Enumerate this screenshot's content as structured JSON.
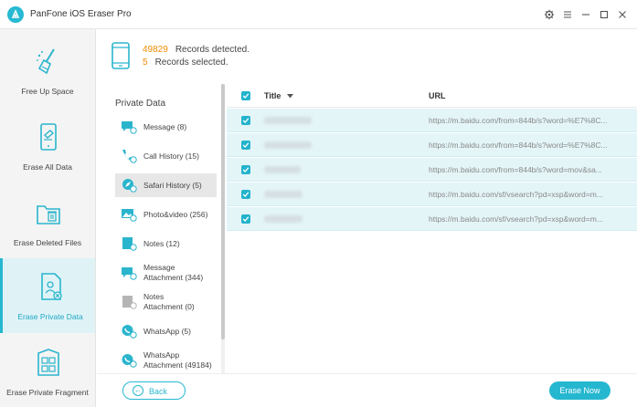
{
  "app": {
    "title": "PanFone iOS Eraser Pro"
  },
  "sidebar": {
    "items": [
      {
        "label": "Free Up Space"
      },
      {
        "label": "Erase All Data"
      },
      {
        "label": "Erase Deleted Files"
      },
      {
        "label": "Erase Private Data"
      },
      {
        "label": "Erase Private Fragment"
      }
    ]
  },
  "summary": {
    "detected_count": "49829",
    "detected_label": "Records detected.",
    "selected_count": "5",
    "selected_label": "Records selected."
  },
  "categories": {
    "heading": "Private Data",
    "items": [
      {
        "line1": "Message (8)",
        "line2": ""
      },
      {
        "line1": "Call History (15)",
        "line2": ""
      },
      {
        "line1": "Safari History (5)",
        "line2": ""
      },
      {
        "line1": "Photo&video (256)",
        "line2": ""
      },
      {
        "line1": "Notes (12)",
        "line2": ""
      },
      {
        "line1": "Message",
        "line2": "Attachment (344)"
      },
      {
        "line1": "Notes",
        "line2": "Attachment (0)"
      },
      {
        "line1": "WhatsApp (5)",
        "line2": ""
      },
      {
        "line1": "WhatsApp",
        "line2": "Attachment (49184)"
      }
    ]
  },
  "table": {
    "col_title": "Title",
    "col_url": "URL",
    "rows": [
      {
        "url": "https://m.baidu.com/from=844b/s?word=%E7%8C..."
      },
      {
        "url": "https://m.baidu.com/from=844b/s?word=%E7%8C..."
      },
      {
        "url": "https://m.baidu.com/from=844b/s?word=mov&sa..."
      },
      {
        "url": "https://m.baidu.com/sf/vsearch?pd=xsp&word=m..."
      },
      {
        "url": "https://m.baidu.com/sf/vsearch?pd=xsp&word=m..."
      }
    ]
  },
  "footer": {
    "back_label": "Back",
    "erase_label": "Erase Now"
  },
  "colors": {
    "accent": "#26b7d0",
    "count": "#f08c00",
    "row_selected": "#e4f5f8"
  }
}
